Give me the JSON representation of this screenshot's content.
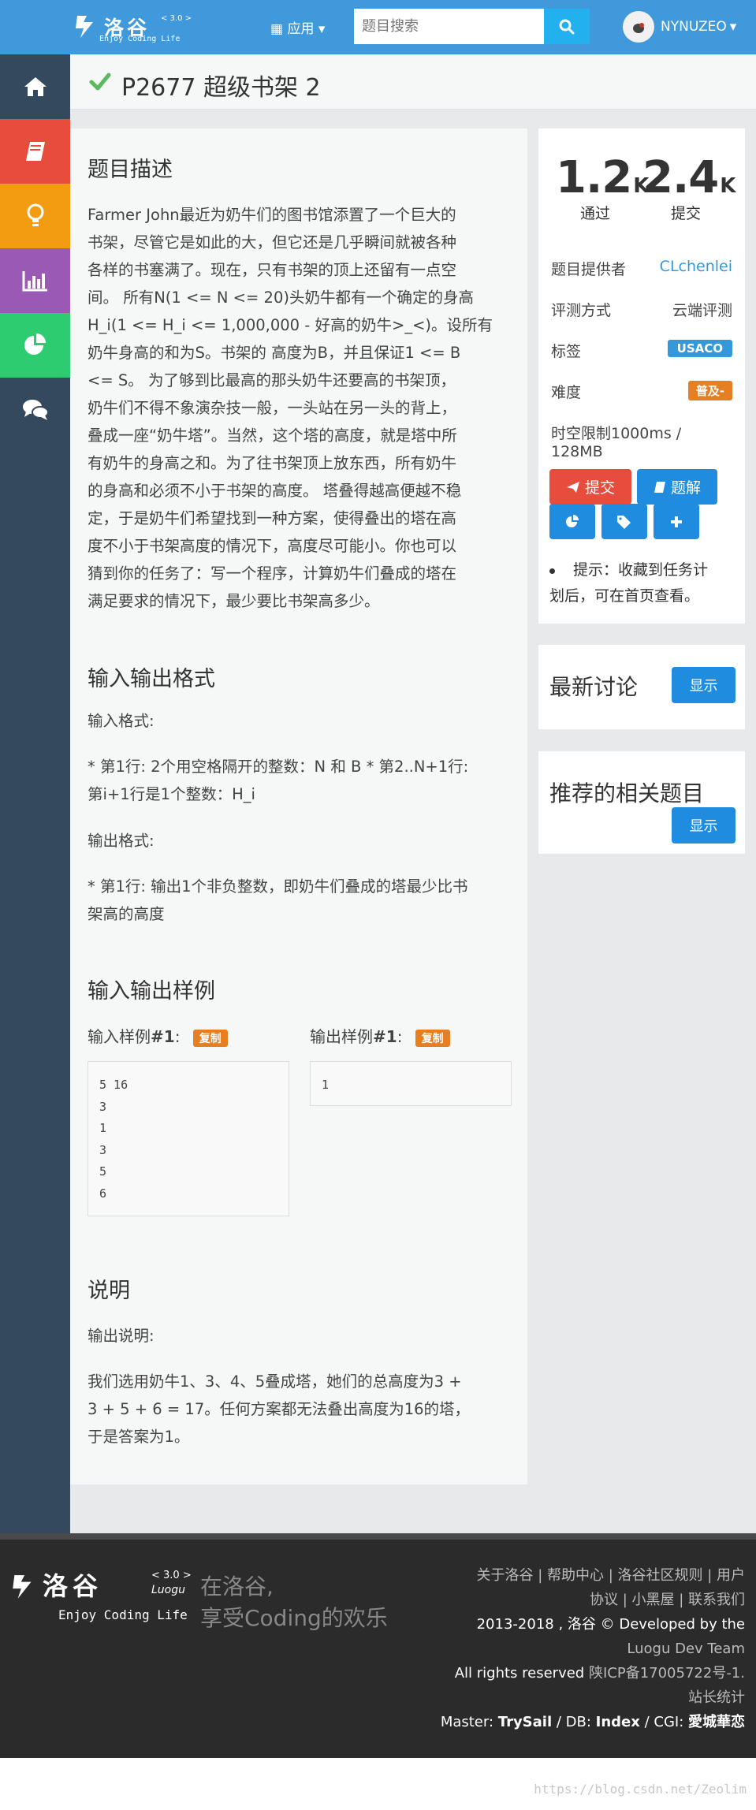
{
  "header": {
    "logo_text": "洛谷",
    "logo_version": "< 3.0 >",
    "logo_sub": "Enjoy Coding Life",
    "logo_luogu": "Luogu",
    "app_menu_label": "应用",
    "search_placeholder": "题目搜索",
    "username": "NYNUZEO"
  },
  "sidebar": {
    "items": [
      {
        "icon": "home-icon"
      },
      {
        "icon": "book-icon"
      },
      {
        "icon": "lightbulb-icon"
      },
      {
        "icon": "bar-chart-icon"
      },
      {
        "icon": "pie-chart-icon"
      },
      {
        "icon": "comments-icon"
      }
    ],
    "colors": [
      "#34495e",
      "#e74c3c",
      "#f39c12",
      "#9b59b6",
      "#2ecc71",
      "#34495e"
    ]
  },
  "problem": {
    "title": "P2677 超级书架 2",
    "status": "accepted"
  },
  "description": {
    "heading": "题目描述",
    "lines": [
      "Farmer John最近为奶牛们的图书馆添置了一个巨大的",
      "书架，尽管它是如此的大，但它还是几乎瞬间就被各种",
      "各样的书塞满了。现在，只有书架的顶上还留有一点空",
      "间。 所有N(1 <= N <= 20)头奶牛都有一个确定的身高",
      "H_i(1 <= H_i <= 1,000,000 - 好高的奶牛>_<)。设所有",
      "奶牛身高的和为S。书架的 高度为B，并且保证1 <= B",
      "<= S。 为了够到比最高的那头奶牛还要高的书架顶，",
      "奶牛们不得不象演杂技一般，一头站在另一头的背上，",
      "叠成一座“奶牛塔”。当然，这个塔的高度，就是塔中所",
      "有奶牛的身高之和。为了往书架顶上放东西，所有奶牛",
      "的身高和必须不小于书架的高度。 塔叠得越高便越不稳",
      "定，于是奶牛们希望找到一种方案，使得叠出的塔在高",
      "度不小于书架高度的情况下，高度尽可能小。你也可以",
      "猜到你的任务了：写一个程序，计算奶牛们叠成的塔在",
      "满足要求的情况下，最少要比书架高多少。"
    ]
  },
  "io_format": {
    "heading": "输入输出格式",
    "input_label": "输入格式:",
    "input_lines": [
      "* 第1行: 2个用空格隔开的整数：N 和 B * 第2..N+1行:",
      "第i+1行是1个整数：H_i"
    ],
    "output_label": "输出格式:",
    "output_lines": [
      "* 第1行: 输出1个非负整数，即奶牛们叠成的塔最少比书",
      "架高的高度"
    ]
  },
  "samples": {
    "heading": "输入输出样例",
    "input_label": "输入样例",
    "input_num": "#1",
    "output_label": "输出样例",
    "output_num": "#1",
    "copy_label": "复制",
    "input_data": "5 16\n3\n1\n3\n5\n6",
    "output_data": "1"
  },
  "explanation": {
    "heading": "说明",
    "label": "输出说明:",
    "lines": [
      "我们选用奶牛1、3、4、5叠成塔，她们的总高度为3 +",
      "3 + 5 + 6 = 17。任何方案都无法叠出高度为16的塔，",
      "于是答案为1。"
    ]
  },
  "stats": {
    "passed_value": "1.2",
    "passed_unit": "K",
    "passed_label": "通过",
    "submitted_value": "2.4",
    "submitted_unit": "K",
    "submitted_label": "提交"
  },
  "info": {
    "provider_label": "题目提供者",
    "provider_value": "CLchenlei",
    "judge_label": "评测方式",
    "judge_value": "云端评测",
    "tags_label": "标签",
    "tag_value": "USACO",
    "difficulty_label": "难度",
    "difficulty_value": "普及-",
    "limit_text": "时空限制1000ms / 128MB"
  },
  "actions": {
    "submit_label": "提交",
    "solution_label": "题解",
    "tip_lines": [
      "提示：收藏到任务计",
      "划后，可在首页查看。"
    ]
  },
  "discussion": {
    "title": "最新讨论",
    "show_label": "显示"
  },
  "related": {
    "title": "推荐的相关题目",
    "show_label": "显示"
  },
  "footer": {
    "slogan_1": "在洛谷,",
    "slogan_2": "享受Coding的欢乐",
    "links_line_1": "关于洛谷 | 帮助中心 | 洛谷社区规则 | 用户",
    "links_line_2": "协议 | 小黑屋 | 联系我们",
    "copyright_1": "2013-2018 , 洛谷 © Developed by the",
    "copyright_2": "Luogu Dev Team",
    "rights_1": "All rights reserved",
    "icp": "陕ICP备17005722号-1.",
    "stats_link": "站长统计",
    "master_prefix": "Master: ",
    "master": "TrySail",
    "db_prefix": " / DB: ",
    "db": "Index",
    "cgi_prefix": " / CGI: ",
    "cgi": "愛城華恋"
  },
  "watermark": "https://blog.csdn.net/Zeolim"
}
